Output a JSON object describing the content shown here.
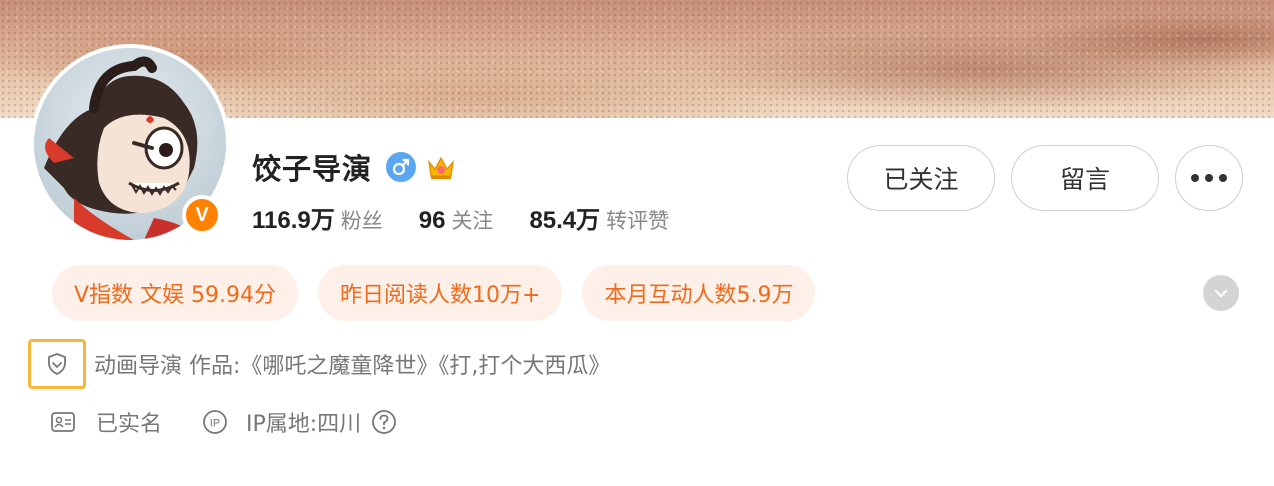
{
  "profile": {
    "name": "饺子导演",
    "gender_icon": "male-icon",
    "crown_icon": "crown-icon",
    "verified_badge": "V"
  },
  "stats": [
    {
      "value": "116.9万",
      "label": "粉丝"
    },
    {
      "value": "96",
      "label": "关注"
    },
    {
      "value": "85.4万",
      "label": "转评赞"
    }
  ],
  "actions": {
    "follow_label": "已关注",
    "message_label": "留言",
    "more_icon": "more-icon"
  },
  "tags": [
    "V指数 文娱 59.94分",
    "昨日阅读人数10万+",
    "本月互动人数5.9万"
  ],
  "bio": {
    "text": "动画导演 作品:《哪吒之魔童降世》《打,打个大西瓜》",
    "icon": "shield-icon"
  },
  "details": {
    "real_name": "已实名",
    "ip_label": "IP属地:四川"
  },
  "colors": {
    "accent": "#ff8200",
    "tag_text": "#f06a1c",
    "tag_bg": "#fdf0e8",
    "highlight_border": "#f6b73c",
    "gender_blue": "#5aa6f0"
  }
}
